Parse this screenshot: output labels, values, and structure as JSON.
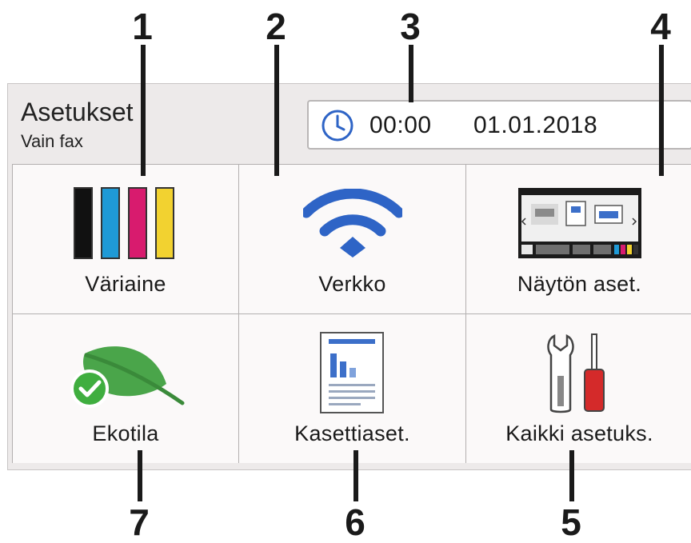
{
  "callouts": {
    "c1": "1",
    "c2": "2",
    "c3": "3",
    "c4": "4",
    "c5": "5",
    "c6": "6",
    "c7": "7"
  },
  "header": {
    "title": "Asetukset",
    "subtitle": "Vain fax",
    "time": "00:00",
    "date": "01.01.2018"
  },
  "tiles": [
    {
      "label": "Väriaine",
      "icon": "toner-icon"
    },
    {
      "label": "Verkko",
      "icon": "wifi-icon"
    },
    {
      "label": "Näytön aset.",
      "icon": "screen-settings-icon"
    },
    {
      "label": "Ekotila",
      "icon": "eco-leaf-icon"
    },
    {
      "label": "Kasettiaset.",
      "icon": "tray-settings-icon"
    },
    {
      "label": "Kaikki asetuks.",
      "icon": "tools-icon"
    }
  ],
  "colors": {
    "black": "#111111",
    "cyan": "#1f9ad6",
    "magenta": "#d81b6e",
    "yellow": "#f2d230",
    "wifi": "#2e64c6",
    "leaf": "#4aa54a",
    "check": "#3fae3f",
    "screwdriver": "#d42a2a"
  }
}
